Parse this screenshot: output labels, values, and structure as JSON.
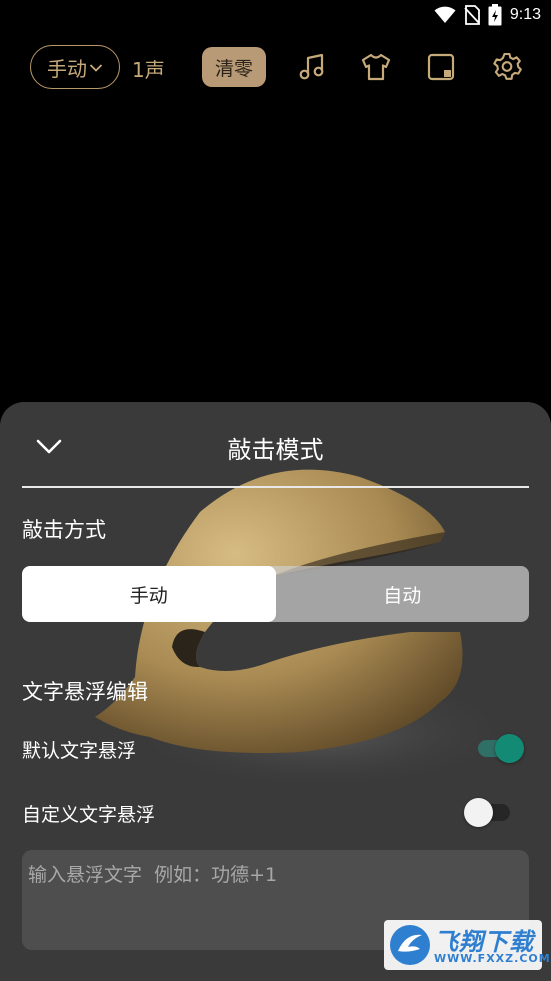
{
  "status_bar": {
    "time": "9:13",
    "icons": [
      "wifi-icon",
      "no-sim-icon",
      "battery-icon"
    ]
  },
  "toolbar": {
    "mode_label": "手动",
    "sound_count": "1声",
    "clear_label": "清零",
    "icons": [
      "music-note-icon",
      "tshirt-icon",
      "layout-icon",
      "gear-icon"
    ]
  },
  "sheet": {
    "title": "敲击模式",
    "strike_section": "敲击方式",
    "segments": {
      "manual": "手动",
      "auto": "自动",
      "selected": "手动"
    },
    "float_section": "文字悬浮编辑",
    "default_float_label": "默认文字悬浮",
    "default_float_on": true,
    "custom_float_label": "自定义文字悬浮",
    "custom_float_on": false,
    "input_placeholder": "输入悬浮文字  例如：功德+1"
  },
  "watermark": {
    "text": "飞翔下载",
    "url": "WWW.FXXZ.COM"
  },
  "colors": {
    "accent_gold": "#b89a6a",
    "toggle_on": "#138a74",
    "sheet_bg": "#3a3a3a"
  }
}
